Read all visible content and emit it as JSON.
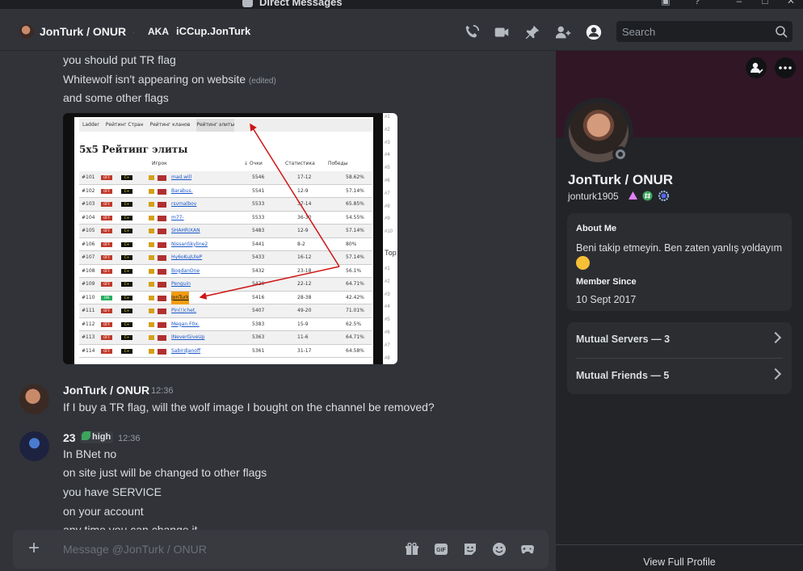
{
  "window": {
    "title": "Direct Messages",
    "controls": [
      "minimize-icon",
      "maximize-icon",
      "close-icon"
    ]
  },
  "header": {
    "username": "JonTurk / ONUR",
    "aka_label": "AKA",
    "aka_name": "iCCup.JonTurk",
    "icons": [
      "voice-call-icon",
      "video-call-icon",
      "pin-icon",
      "add-friends-icon",
      "user-profile-icon"
    ],
    "search_placeholder": "Search"
  },
  "messages": {
    "continued": [
      {
        "text": "you should put TR flag",
        "edited": ""
      },
      {
        "text": "Whitewolf isn't appearing on website",
        "edited": "(edited)"
      },
      {
        "text": "and some other flags",
        "edited": ""
      }
    ],
    "embed": {
      "tabs": [
        "Ladder",
        "Рейтинг Стран",
        "Рейтинг кланов",
        "Рейтинг элиты"
      ],
      "title": "5x5 Рейтинг элиты",
      "columns": [
        "Игрок",
        "↓ Очки",
        "Статистика",
        "Победы"
      ],
      "side_label": "Тор",
      "side_ranks": [
        "#1",
        "#2",
        "#3",
        "#4",
        "#5",
        "#6",
        "#7",
        "#8",
        "#9",
        "#10"
      ],
      "side_ranks2": [
        "#1",
        "#2",
        "#3",
        "#4",
        "#5",
        "#6",
        "#7",
        "#8"
      ],
      "rows": [
        {
          "rank": "#101",
          "status": "OFF",
          "clan": "C+",
          "player": "mad.will",
          "points": "5546",
          "stats": "17-12",
          "win": "58.62%"
        },
        {
          "rank": "#102",
          "status": "OFF",
          "clan": "C+",
          "player": "Barabus.",
          "points": "5541",
          "stats": "12-9",
          "win": "57.14%"
        },
        {
          "rank": "#103",
          "status": "OFF",
          "clan": "C+",
          "player": "rsvmalbov",
          "points": "5533",
          "stats": "37-14",
          "win": "65.85%"
        },
        {
          "rank": "#104",
          "status": "OFF",
          "clan": "C+",
          "player": "m77-",
          "points": "5533",
          "stats": "36-30",
          "win": "54.55%"
        },
        {
          "rank": "#105",
          "status": "OFF",
          "clan": "C+",
          "player": "SHAHRIXAN",
          "points": "5483",
          "stats": "12-9",
          "win": "57.14%"
        },
        {
          "rank": "#106",
          "status": "OFF",
          "clan": "C+",
          "player": "NissanSkyline2",
          "points": "5441",
          "stats": "8-2",
          "win": "80%"
        },
        {
          "rank": "#107",
          "status": "OFF",
          "clan": "C+",
          "player": "Hy6oKuJUleP",
          "points": "5433",
          "stats": "16-12",
          "win": "57.14%"
        },
        {
          "rank": "#108",
          "status": "OFF",
          "clan": "C+",
          "player": "BogdanOne",
          "points": "5432",
          "stats": "23-18",
          "win": "56.1%"
        },
        {
          "rank": "#109",
          "status": "OFF",
          "clan": "C+",
          "player": "Penguin",
          "points": "5420",
          "stats": "22-12",
          "win": "64.71%"
        },
        {
          "rank": "#110",
          "status": "ON",
          "clan": "C+",
          "player": "JonTurk",
          "points": "5416",
          "stats": "28-38",
          "win": "42.42%"
        },
        {
          "rank": "#111",
          "status": "OFF",
          "clan": "C+",
          "player": "Pin(!)chet.",
          "points": "5407",
          "stats": "49-20",
          "win": "71.01%"
        },
        {
          "rank": "#112",
          "status": "OFF",
          "clan": "C+",
          "player": "Megan.F0x.",
          "points": "5383",
          "stats": "15-9",
          "win": "62.5%"
        },
        {
          "rank": "#113",
          "status": "OFF",
          "clan": "C+",
          "player": "INeverGiveUp",
          "points": "5363",
          "stats": "11-6",
          "win": "64.71%"
        },
        {
          "rank": "#114",
          "status": "OFF",
          "clan": "C+",
          "player": "Sabirdjanoff",
          "points": "5361",
          "stats": "31-17",
          "win": "64.58%"
        }
      ]
    },
    "groups": [
      {
        "author": "JonTurk / ONUR",
        "time": "12:36",
        "lines": [
          "If I buy a TR flag, will the wolf image I bought on the channel be removed?"
        ]
      },
      {
        "author": "23",
        "tag": "high",
        "time": "12:36",
        "lines": [
          "In BNet no",
          "on site just will be changed to other flags",
          "you have SERVICE",
          "on your account",
          "any time you can change it"
        ]
      }
    ]
  },
  "composer": {
    "placeholder": "Message @JonTurk / ONUR",
    "icons": [
      "gift-icon",
      "gif-icon",
      "sticker-icon",
      "emoji-icon",
      "activity-icon"
    ],
    "gif_label": "GIF"
  },
  "profile": {
    "display_name": "JonTurk / ONUR",
    "username": "jonturk1905",
    "about_label": "About Me",
    "about_text": "Beni takip etmeyin. Ben zaten yanlış yoldayım",
    "member_since_label": "Member Since",
    "member_since": "10 Sept 2017",
    "mutual_servers": "Mutual Servers — 3",
    "mutual_friends": "Mutual Friends — 5",
    "view_full": "View Full Profile",
    "banner_color": "#311626",
    "status": "offline"
  }
}
